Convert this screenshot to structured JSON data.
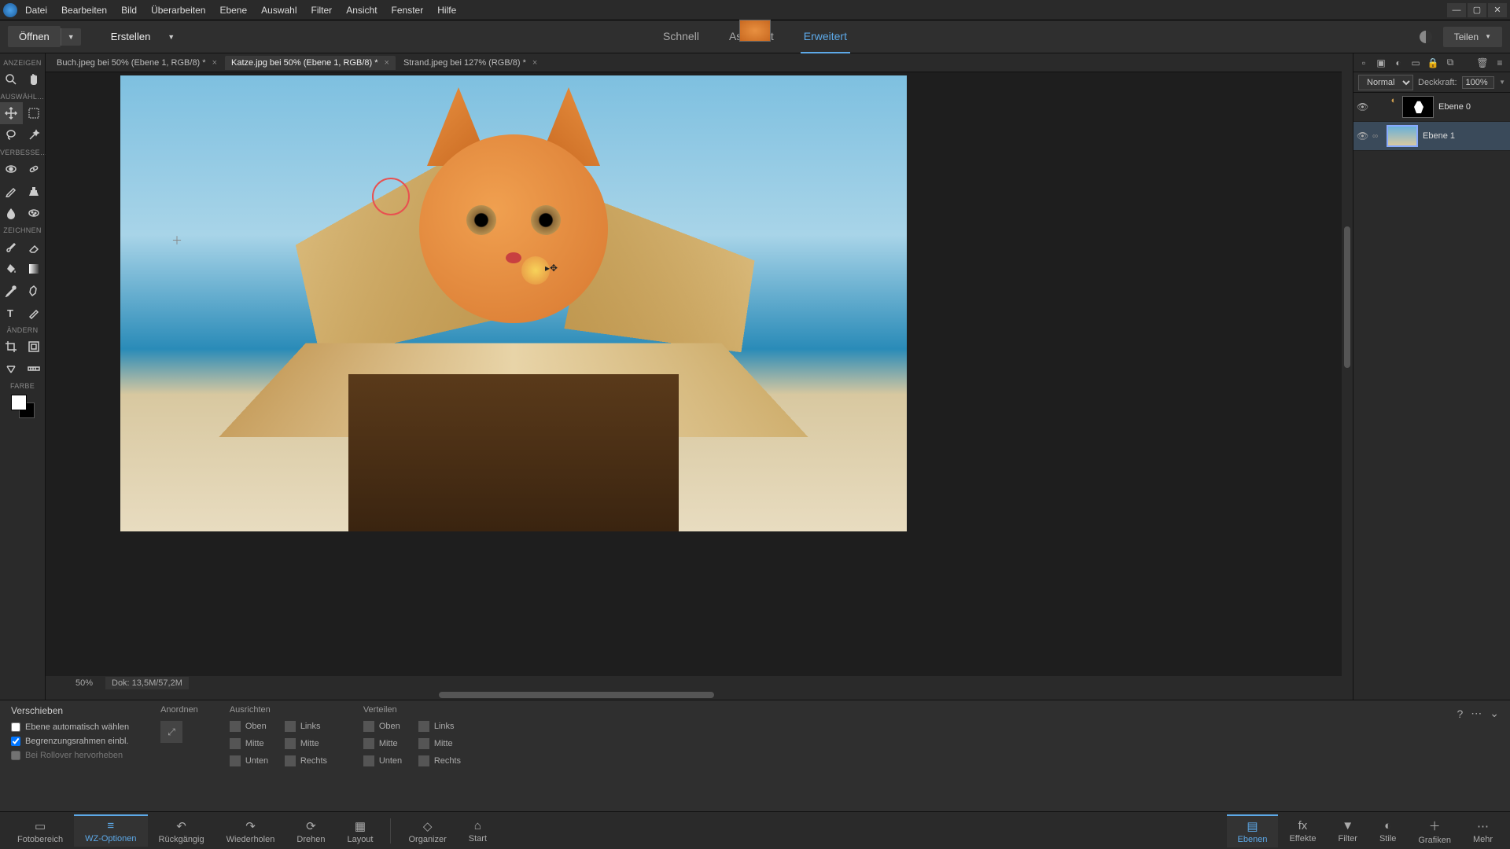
{
  "menubar": [
    "Datei",
    "Bearbeiten",
    "Bild",
    "Überarbeiten",
    "Ebene",
    "Auswahl",
    "Filter",
    "Ansicht",
    "Fenster",
    "Hilfe"
  ],
  "secondbar": {
    "open": "Öffnen",
    "create": "Erstellen",
    "modes": [
      "Schnell",
      "Assistent",
      "Erweitert"
    ],
    "active_mode": 2,
    "share": "Teilen"
  },
  "doc_tabs": [
    {
      "label": "Buch.jpeg bei 50% (Ebene 1, RGB/8) *",
      "active": false
    },
    {
      "label": "Katze.jpg bei 50% (Ebene 1, RGB/8) *",
      "active": true
    },
    {
      "label": "Strand.jpeg bei 127% (RGB/8) *",
      "active": false
    }
  ],
  "toolbox_sections": {
    "anzeigen": "ANZEIGEN",
    "auswaehlen": "AUSWÄHL…",
    "verbessern": "VERBESSE…",
    "zeichnen": "ZEICHNEN",
    "aendern": "ÄNDERN",
    "farbe": "FARBE"
  },
  "status": {
    "zoom": "50%",
    "dok": "Dok:  13,5M/57,2M"
  },
  "layers": {
    "toolbar_icons": [
      "new-layer",
      "new-group",
      "adjust",
      "mask",
      "lock",
      "fx"
    ],
    "blend_mode": "Normal",
    "opacity_label": "Deckkraft:",
    "opacity_value": "100%",
    "rows": [
      {
        "name": "Ebene 0",
        "selected": false
      },
      {
        "name": "Ebene 1",
        "selected": true
      }
    ]
  },
  "options": {
    "tool_title": "Verschieben",
    "checks": [
      {
        "label": "Ebene automatisch wählen",
        "checked": false,
        "enabled": true
      },
      {
        "label": "Begrenzungsrahmen einbl.",
        "checked": true,
        "enabled": true
      },
      {
        "label": "Bei Rollover hervorheben",
        "checked": false,
        "enabled": false
      }
    ],
    "arrange_label": "Anordnen",
    "align_label": "Ausrichten",
    "align_items_col1": [
      "Oben",
      "Mitte",
      "Unten"
    ],
    "align_items_col2": [
      "Links",
      "Mitte",
      "Rechts"
    ],
    "distribute_label": "Verteilen",
    "dist_items_col1": [
      "Oben",
      "Mitte",
      "Unten"
    ],
    "dist_items_col2": [
      "Links",
      "Mitte",
      "Rechts"
    ]
  },
  "bottombar": {
    "left": [
      {
        "label": "Fotobereich",
        "icon": "▭"
      },
      {
        "label": "WZ-Optionen",
        "icon": "≡",
        "active": true
      },
      {
        "label": "Rückgängig",
        "icon": "↶"
      },
      {
        "label": "Wiederholen",
        "icon": "↷"
      },
      {
        "label": "Drehen",
        "icon": "⟳"
      },
      {
        "label": "Layout",
        "icon": "▦"
      }
    ],
    "center": [
      {
        "label": "Organizer",
        "icon": "◇"
      },
      {
        "label": "Start",
        "icon": "⌂"
      }
    ],
    "right": [
      {
        "label": "Ebenen",
        "icon": "▤",
        "active": true
      },
      {
        "label": "Effekte",
        "icon": "fx"
      },
      {
        "label": "Filter",
        "icon": "▼"
      },
      {
        "label": "Stile",
        "icon": "◐"
      },
      {
        "label": "Grafiken",
        "icon": "＋"
      },
      {
        "label": "Mehr",
        "icon": "⋯"
      }
    ]
  }
}
